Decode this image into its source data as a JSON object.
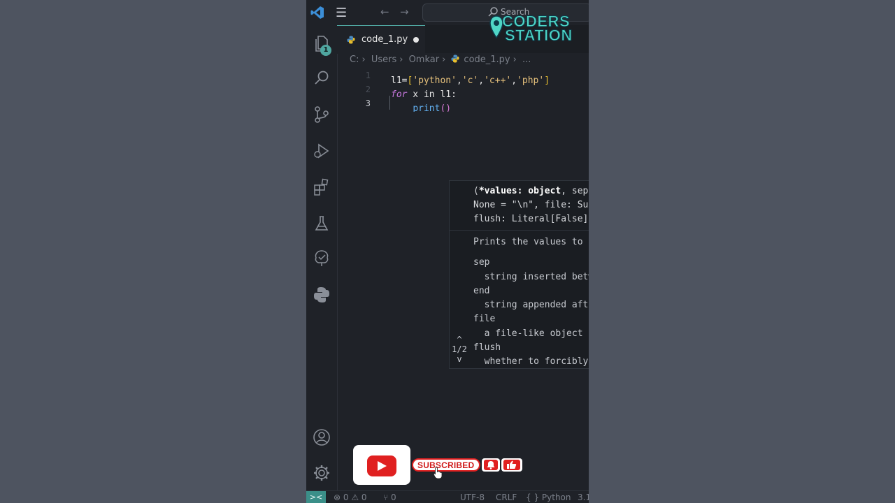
{
  "titlebar": {
    "search_label": "Search"
  },
  "activity": {
    "explorer_badge": "1"
  },
  "tab": {
    "label": "code_1.py"
  },
  "breadcrumb": {
    "drive": "C:",
    "users": "Users",
    "user": "Omkar",
    "file": "code_1.py",
    "more": "..."
  },
  "editor": {
    "line_numbers": [
      "1",
      "2",
      "3"
    ],
    "line1": {
      "ident": "l1=",
      "open": "[",
      "s1": "'python'",
      "c1": ",",
      "s2": "'c'",
      "c2": ",",
      "s3": "'c++'",
      "c3": ",",
      "s4": "'php'",
      "close": "]"
    },
    "line2": {
      "kw": "for",
      "rest": " x in l1:"
    },
    "line3": {
      "indent": "    ",
      "fn": "print",
      "paren": "()"
    }
  },
  "hover": {
    "nav_up": "^",
    "nav_count": "1/2",
    "nav_down": "v",
    "sig_line1_prefix": "(",
    "sig_line1_bold": "*values: object",
    "sig_line1_rest": ", sep: str",
    "sig_line2": "None = \"\\n\", file: Support",
    "sig_line3": "flush: Literal[False] = Fa",
    "doc": [
      "Prints the values to a stream, or",
      "",
      "sep",
      "  string inserted between values",
      "end",
      "  string appended after the last ",
      "file",
      "  a file-like object (stream); defa",
      "flush",
      "  whether to forcibly flush the st"
    ]
  },
  "overlay": {
    "subscribe_label": "SUBSCRIBED",
    "logo_line1": "CODERS",
    "logo_line2": "STATION"
  },
  "statusbar": {
    "remote": "><",
    "errors": "⊗ 0 ⚠ 0",
    "ports": "⑂ 0",
    "encoding": "UTF-8",
    "eol": "CRLF",
    "language": "{ } Python",
    "version": "3.1"
  },
  "colors": {
    "accent": "#4fa6a0",
    "background": "#1f2228",
    "youtube_red": "#e02020"
  }
}
